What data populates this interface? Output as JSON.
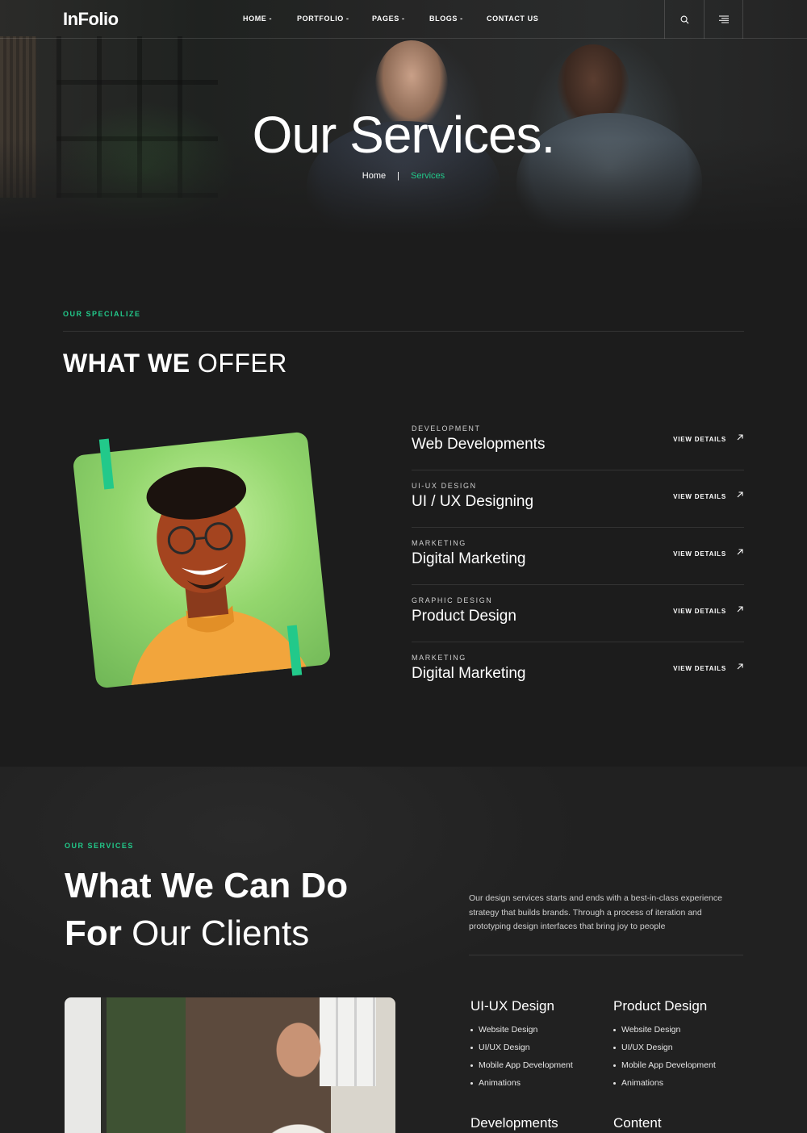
{
  "nav": {
    "logo": "InFolio",
    "items": [
      {
        "label": "HOME -"
      },
      {
        "label": "PORTFOLIO -"
      },
      {
        "label": "PAGES -"
      },
      {
        "label": "BLOGS -"
      },
      {
        "label": "CONTACT US"
      }
    ],
    "icons": [
      "search-icon",
      "menu-lines-icon"
    ]
  },
  "hero": {
    "title": "Our Services.",
    "breadcrumb": {
      "home": "Home",
      "separator": "|",
      "current": "Services"
    }
  },
  "offer": {
    "eyebrow": "OUR SPECIALIZE",
    "title_bold": "WHAT WE",
    "title_light": "OFFER",
    "services": [
      {
        "category": "DEVELOPMENT",
        "name": "Web Developments",
        "link": "VIEW DETAILS"
      },
      {
        "category": "UI-UX DESIGN",
        "name": "UI / UX Designing",
        "link": "VIEW DETAILS"
      },
      {
        "category": "MARKETING",
        "name": "Digital Marketing",
        "link": "VIEW DETAILS"
      },
      {
        "category": "GRAPHIC DESIGN",
        "name": "Product Design",
        "link": "VIEW DETAILS"
      },
      {
        "category": "MARKETING",
        "name": "Digital Marketing",
        "link": "VIEW DETAILS"
      }
    ]
  },
  "cando": {
    "eyebrow": "OUR SERVICES",
    "title_line1": "What We Can Do",
    "title_bold2": "For",
    "title_light2": "Our Clients",
    "description": "Our design services starts and ends with a best-in-class experience strategy that builds brands. Through a process of iteration and prototyping design interfaces that bring joy to people",
    "columns": [
      {
        "heading": "UI-UX Design",
        "items": [
          "Website Design",
          "UI/UX Design",
          "Mobile App Development",
          "Animations"
        ]
      },
      {
        "heading": "Product Design",
        "items": [
          "Website Design",
          "UI/UX Design",
          "Mobile App Development",
          "Animations"
        ]
      },
      {
        "heading": "Developments",
        "items": []
      },
      {
        "heading": "Content",
        "items": []
      }
    ]
  },
  "colors": {
    "accent": "#22c98a",
    "background": "#1c1c1c"
  }
}
